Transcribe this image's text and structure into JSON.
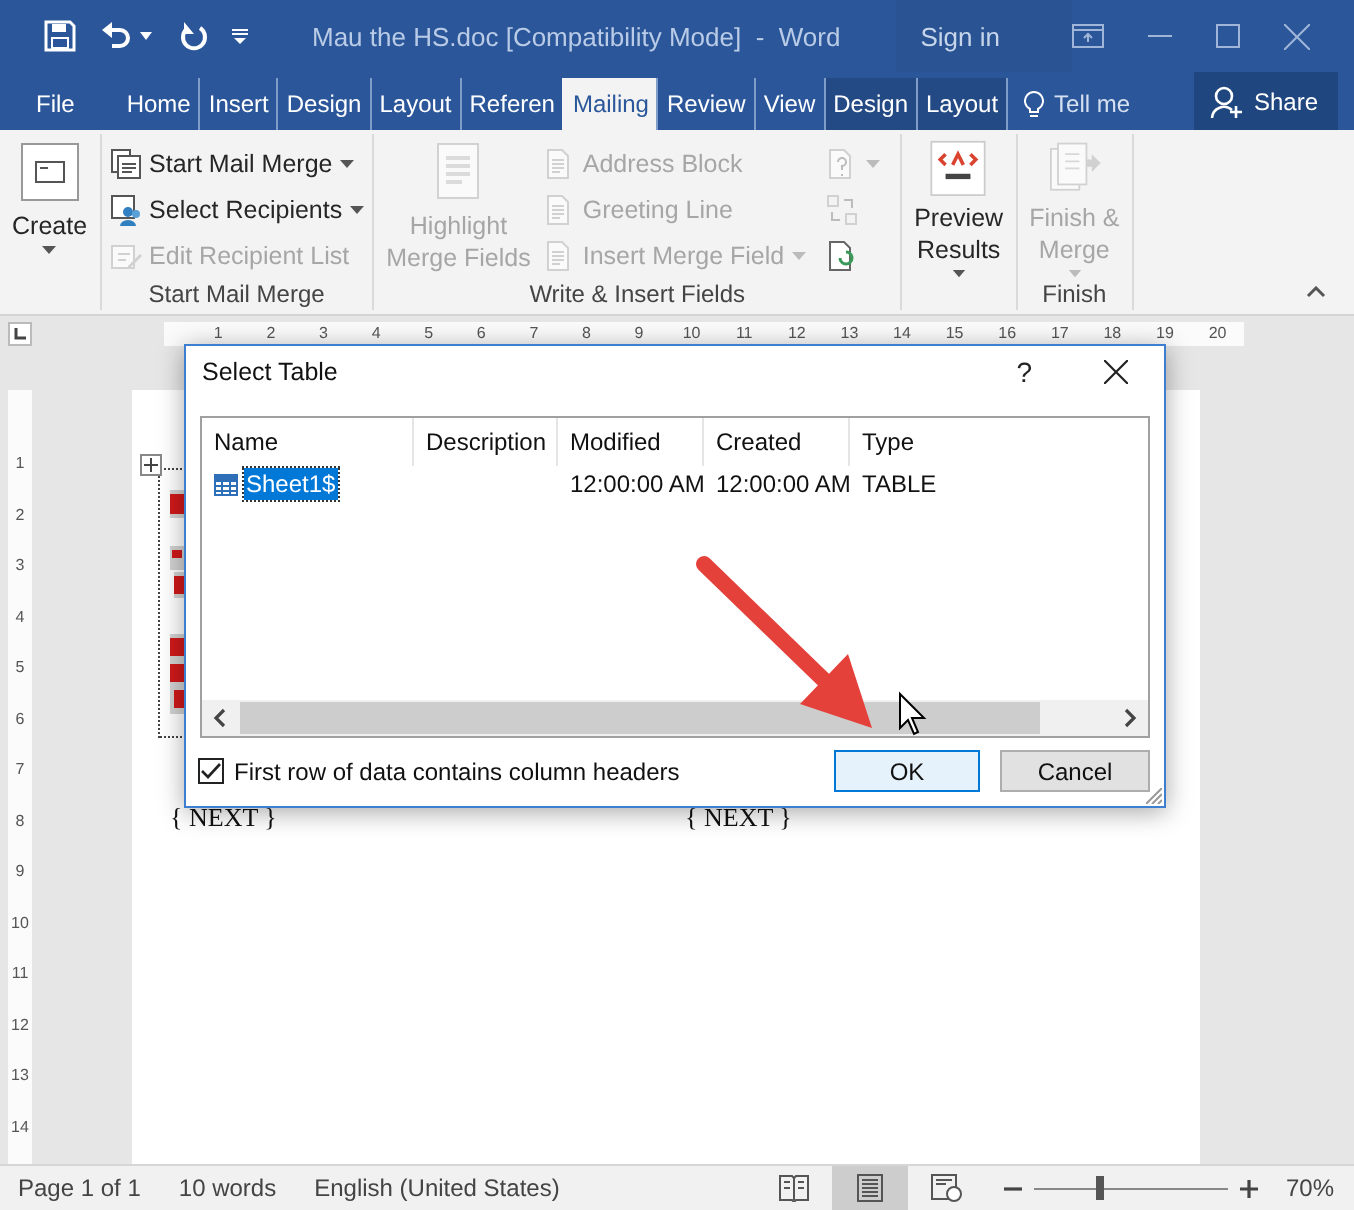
{
  "window": {
    "title": "Mau the HS.doc [Compatibility Mode]  -  Word",
    "sign_in": "Sign in"
  },
  "tabs": [
    {
      "label": "File",
      "kind": "file",
      "selected": false
    },
    {
      "label": "Home",
      "kind": "tab",
      "selected": false
    },
    {
      "label": "Insert",
      "kind": "tab",
      "selected": false
    },
    {
      "label": "Design",
      "kind": "tab",
      "selected": false
    },
    {
      "label": "Layout",
      "kind": "tab",
      "selected": false
    },
    {
      "label": "Referen",
      "kind": "tab",
      "selected": false
    },
    {
      "label": "Mailing",
      "kind": "tab",
      "selected": true
    },
    {
      "label": "Review",
      "kind": "tab",
      "selected": false
    },
    {
      "label": "View",
      "kind": "tab",
      "selected": false
    },
    {
      "label": "Design",
      "kind": "contextual",
      "selected": false
    },
    {
      "label": "Layout",
      "kind": "contextual",
      "selected": false
    }
  ],
  "tell_me": "Tell me",
  "share": "Share",
  "ribbon": [
    {
      "items": [
        {
          "kind": "large",
          "label": "Create",
          "dropdown": true,
          "disabled": false
        }
      ]
    },
    {
      "label": "Start Mail Merge",
      "items": [
        {
          "kind": "small",
          "label": "Start Mail Merge",
          "dropdown": true,
          "disabled": false
        },
        {
          "kind": "small",
          "label": "Select Recipients",
          "dropdown": true,
          "disabled": false
        },
        {
          "kind": "small",
          "label": "Edit Recipient List",
          "dropdown": false,
          "disabled": true
        }
      ]
    },
    {
      "label": "Write & Insert Fields",
      "items": [
        {
          "kind": "large",
          "label": "Highlight\nMerge Fields",
          "dropdown": false,
          "disabled": true
        },
        {
          "kind": "small",
          "label": "Address Block",
          "dropdown": false,
          "disabled": true
        },
        {
          "kind": "small",
          "label": "Greeting Line",
          "dropdown": false,
          "disabled": true
        },
        {
          "kind": "small",
          "label": "Insert Merge Field",
          "dropdown": true,
          "disabled": true
        },
        {
          "kind": "icon",
          "dropdown": true,
          "disabled": true
        },
        {
          "kind": "icon",
          "dropdown": false,
          "disabled": true
        },
        {
          "kind": "icon",
          "dropdown": false,
          "disabled": false
        }
      ]
    },
    {
      "items": [
        {
          "kind": "large",
          "label": "Preview\nResults",
          "dropdown": true,
          "disabled": false
        }
      ]
    },
    {
      "label": "Finish",
      "items": [
        {
          "kind": "large",
          "label": "Finish &\nMerge",
          "dropdown": true,
          "disabled": true
        }
      ]
    }
  ],
  "ruler": {
    "horizontal": [
      "1",
      "2",
      "3",
      "4",
      "5",
      "6",
      "7",
      "8",
      "9",
      "10",
      "11",
      "12",
      "13",
      "14",
      "15",
      "16",
      "17",
      "18",
      "19",
      "20"
    ],
    "vertical": [
      "1",
      "2",
      "3",
      "4",
      "5",
      "6",
      "7",
      "8",
      "9",
      "10",
      "11",
      "12",
      "13",
      "14"
    ]
  },
  "document": {
    "fields": [
      "{ NEXT }",
      "{ NEXT }"
    ]
  },
  "dialog": {
    "title": "Select Table",
    "help": "?",
    "columns": [
      "Name",
      "Description",
      "Modified",
      "Created",
      "Type"
    ],
    "rows": [
      {
        "name": "Sheet1$",
        "modified": "12:00:00 AM",
        "created": "12:00:00 AM",
        "type": "TABLE",
        "selected": true
      }
    ],
    "checkbox": {
      "label": "First row of data contains column headers",
      "checked": true
    },
    "buttons": [
      {
        "label": "OK",
        "kind": "default"
      },
      {
        "label": "Cancel",
        "kind": "normal"
      }
    ]
  },
  "status": {
    "page": "Page 1 of 1",
    "words": "10 words",
    "language": "English (United States)",
    "views": [
      {
        "selected": false
      },
      {
        "selected": true
      },
      {
        "selected": false
      }
    ],
    "zoom_slider": {
      "level": 0.34
    },
    "zoom": "70%"
  }
}
